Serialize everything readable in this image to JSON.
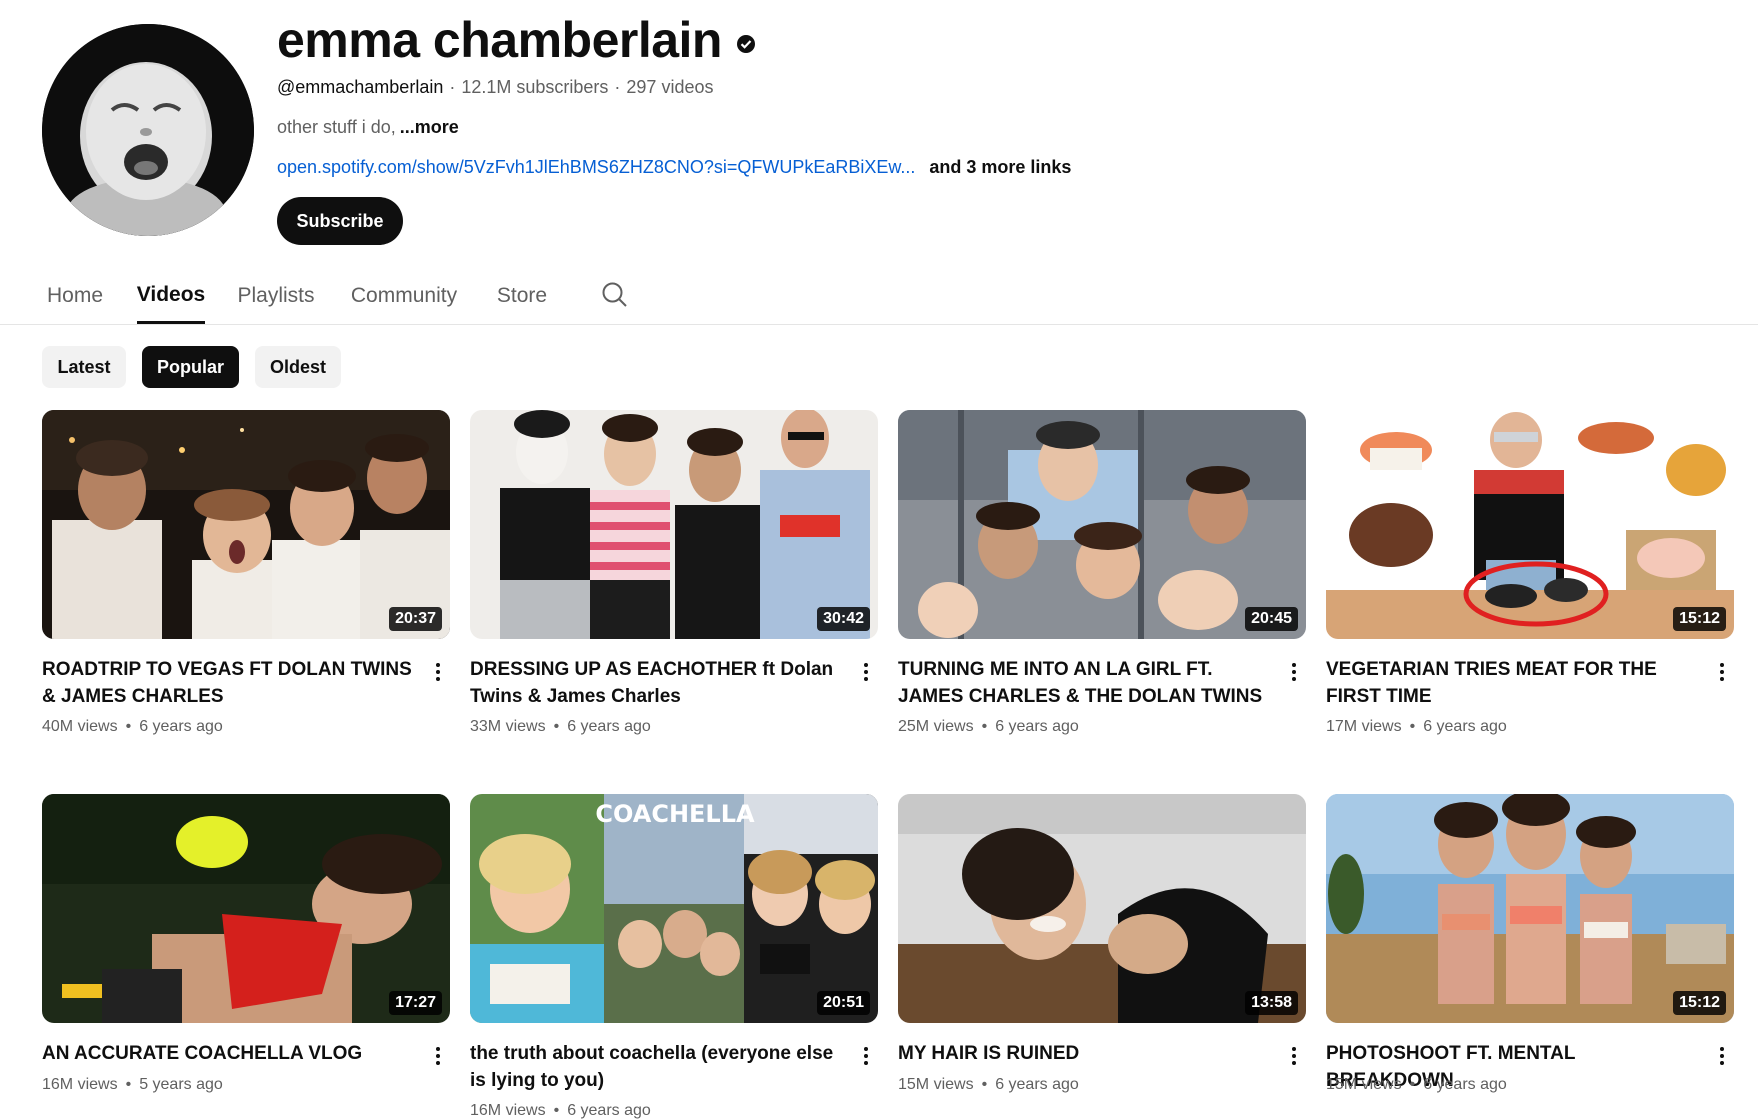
{
  "channel": {
    "name": "emma chamberlain",
    "handle": "@emmachamberlain",
    "subscribers": "12.1M subscribers",
    "video_count": "297 videos",
    "description": "other stuff i do,",
    "more_label": "...more",
    "link": "open.spotify.com/show/5VzFvh1JlEhBMS6ZHZ8CNO?si=QFWUPkEaRBiXEw...",
    "more_links": "and 3 more links",
    "subscribe_label": "Subscribe"
  },
  "tabs": [
    {
      "label": "Home"
    },
    {
      "label": "Videos"
    },
    {
      "label": "Playlists"
    },
    {
      "label": "Community"
    },
    {
      "label": "Store"
    }
  ],
  "active_tab": "Videos",
  "filters": [
    {
      "label": "Latest"
    },
    {
      "label": "Popular"
    },
    {
      "label": "Oldest"
    }
  ],
  "selected_filter": "Popular",
  "videos": [
    {
      "title": "ROADTRIP TO VEGAS FT DOLAN TWINS & JAMES CHARLES",
      "duration": "20:37",
      "views": "40M views",
      "age": "6 years ago"
    },
    {
      "title": "DRESSING UP AS EACHOTHER ft Dolan Twins & James Charles",
      "duration": "30:42",
      "views": "33M views",
      "age": "6 years ago"
    },
    {
      "title": "TURNING ME INTO AN LA GIRL FT. JAMES CHARLES & THE DOLAN TWINS",
      "duration": "20:45",
      "views": "25M views",
      "age": "6 years ago"
    },
    {
      "title": "VEGETARIAN TRIES MEAT FOR THE FIRST TIME",
      "duration": "15:12",
      "views": "17M views",
      "age": "6 years ago"
    },
    {
      "title": "AN ACCURATE COACHELLA VLOG",
      "duration": "17:27",
      "views": "16M views",
      "age": "5 years ago"
    },
    {
      "title": "the truth about coachella (everyone else is lying to you)",
      "duration": "20:51",
      "views": "16M views",
      "age": "6 years ago",
      "thumb_text": "COACHELLA"
    },
    {
      "title": "MY HAIR IS RUINED",
      "duration": "13:58",
      "views": "15M views",
      "age": "6 years ago"
    },
    {
      "title": "PHOTOSHOOT FT. MENTAL BREAKDOWN",
      "duration": "15:12",
      "views": "15M views",
      "age": "6 years ago"
    }
  ],
  "icons": {
    "verified": "verified-check-icon",
    "search": "search-icon",
    "more": "more-vert-icon"
  },
  "colors": {
    "link": "#065fd4",
    "text": "#0f0f0f",
    "secondary_text": "#606060",
    "chip_bg": "#f2f2f2"
  }
}
